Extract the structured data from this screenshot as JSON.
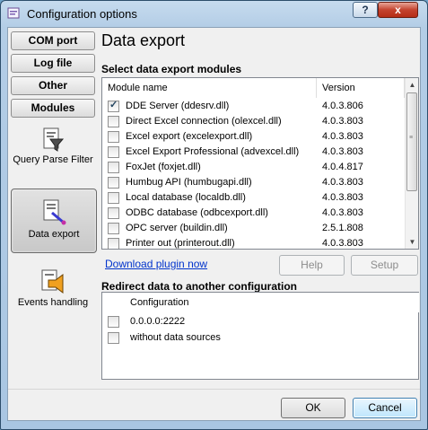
{
  "window": {
    "title": "Configuration options",
    "help_label": "?",
    "close_label": "x"
  },
  "nav": {
    "buttons": [
      {
        "label": "COM port"
      },
      {
        "label": "Log file"
      },
      {
        "label": "Other"
      },
      {
        "label": "Modules"
      }
    ],
    "items": [
      {
        "label": "Query Parse Filter",
        "icon": "query-parse-filter-icon",
        "selected": false
      },
      {
        "label": "Data export",
        "icon": "data-export-icon",
        "selected": true
      },
      {
        "label": "Events handling",
        "icon": "events-handling-icon",
        "selected": false
      }
    ]
  },
  "main": {
    "title": "Data export",
    "modules": {
      "group_title": "Select data export modules",
      "columns": {
        "name": "Module name",
        "version": "Version"
      },
      "rows": [
        {
          "name": "DDE Server (ddesrv.dll)",
          "version": "4.0.3.806",
          "checked": true
        },
        {
          "name": "Direct Excel connection (olexcel.dll)",
          "version": "4.0.3.803",
          "checked": false
        },
        {
          "name": "Excel export (excelexport.dll)",
          "version": "4.0.3.803",
          "checked": false
        },
        {
          "name": "Excel Export Professional (advexcel.dll)",
          "version": "4.0.3.803",
          "checked": false
        },
        {
          "name": "FoxJet (foxjet.dll)",
          "version": "4.0.4.817",
          "checked": false
        },
        {
          "name": "Humbug API (humbugapi.dll)",
          "version": "4.0.3.803",
          "checked": false
        },
        {
          "name": "Local database (localdb.dll)",
          "version": "4.0.3.803",
          "checked": false
        },
        {
          "name": "ODBC database (odbcexport.dll)",
          "version": "4.0.3.803",
          "checked": false
        },
        {
          "name": "OPC server (buildin.dll)",
          "version": "2.5.1.808",
          "checked": false
        },
        {
          "name": "Printer out (printerout.dll)",
          "version": "4.0.3.803",
          "checked": false
        }
      ]
    },
    "download_link": "Download plugin now",
    "help_button": "Help",
    "setup_button": "Setup",
    "redirect": {
      "group_title": "Redirect data to another configuration",
      "column": "Configuration",
      "rows": [
        {
          "label": "0.0.0.0:2222",
          "checked": false
        },
        {
          "label": "without data sources",
          "checked": false
        }
      ]
    }
  },
  "footer": {
    "ok_label": "OK",
    "cancel_label": "Cancel"
  },
  "colors": {
    "frame": "#b3cde6",
    "link": "#0033cc",
    "close_button": "#c4432e",
    "default_button": "#bee6fd"
  }
}
